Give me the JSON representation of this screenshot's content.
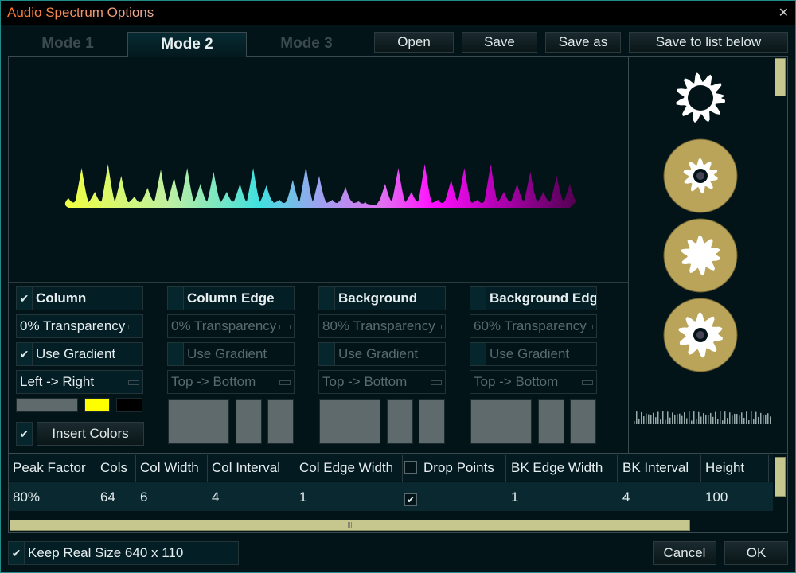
{
  "window": {
    "title": "Audio Spectrum Options",
    "close_icon": "close-icon"
  },
  "tabs": [
    {
      "label": "Mode 1",
      "active": false
    },
    {
      "label": "Mode 2",
      "active": true
    },
    {
      "label": "Mode 3",
      "active": false
    }
  ],
  "toolbar": {
    "open": "Open",
    "save": "Save",
    "save_as": "Save as",
    "save_to_list": "Save to list below"
  },
  "groups": [
    {
      "title": "Column",
      "checked": true,
      "transparency": "0% Transparency",
      "use_gradient": "Use Gradient",
      "gradient_checked": true,
      "direction": "Left -> Right",
      "enabled": true,
      "colors": [
        "#5f6a6d",
        "#ffff00",
        "#000000"
      ],
      "insert_colors": "Insert Colors",
      "insert_checked": true
    },
    {
      "title": "Column Edge",
      "checked": false,
      "transparency": "0% Transparency",
      "use_gradient": "Use Gradient",
      "gradient_checked": false,
      "direction": "Top -> Bottom",
      "enabled": false
    },
    {
      "title": "Background",
      "checked": false,
      "transparency": "80% Transparency",
      "use_gradient": "Use Gradient",
      "gradient_checked": false,
      "direction": "Top -> Bottom",
      "enabled": false
    },
    {
      "title": "Background Edge",
      "checked": false,
      "transparency": "60% Transparency",
      "use_gradient": "Use Gradient",
      "gradient_checked": false,
      "direction": "Top -> Bottom",
      "enabled": false
    }
  ],
  "table": {
    "headers": [
      "Peak Factor",
      "Cols",
      "Col Width",
      "Col Interval",
      "Col Edge Width",
      "Drop Points",
      "BK Edge Width",
      "BK Interval",
      "Height"
    ],
    "values": [
      "80%",
      "64",
      "6",
      "4",
      "1",
      "",
      "1",
      "4",
      "100"
    ],
    "drop_points_checked": true
  },
  "footer": {
    "keep_real_size": "Keep Real Size 640 x 110",
    "keep_checked": true,
    "cancel": "Cancel",
    "ok": "OK"
  },
  "colors": {
    "accent": "#c5c78f",
    "border": "#1f8c8a",
    "title": "#ff7a2a"
  }
}
